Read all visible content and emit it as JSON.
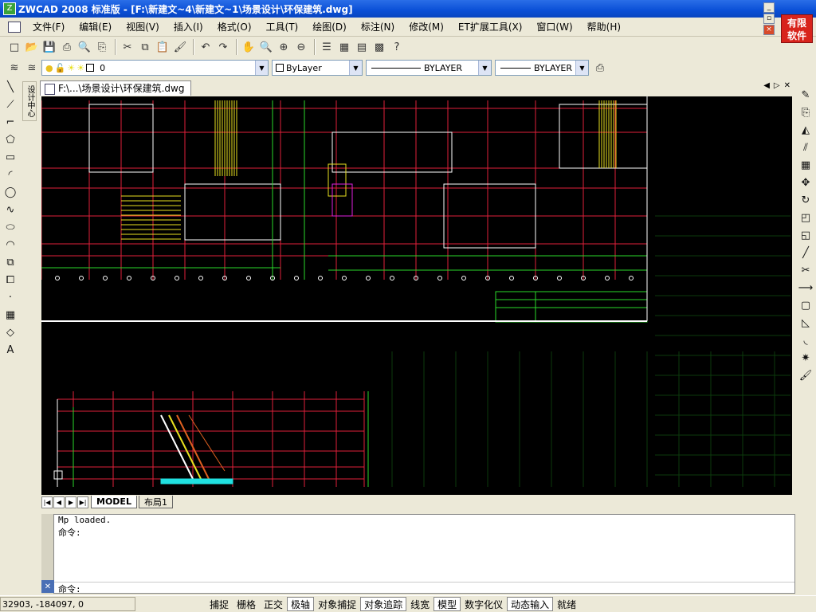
{
  "titlebar": {
    "title": "ZWCAD 2008 标准版 - [F:\\新建文~4\\新建文~1\\场景设计\\环保建筑.dwg]",
    "app_icon": "Z"
  },
  "logo": {
    "line1": "有限",
    "line2": "软件"
  },
  "menu": {
    "items": [
      "文件(F)",
      "编辑(E)",
      "视图(V)",
      "插入(I)",
      "格式(O)",
      "工具(T)",
      "绘图(D)",
      "标注(N)",
      "修改(M)",
      "ET扩展工具(X)",
      "窗口(W)",
      "帮助(H)"
    ]
  },
  "toolbar1": {
    "icons": [
      "new-icon",
      "open-icon",
      "save-icon",
      "print-icon",
      "preview-icon",
      "plot-icon",
      "cut-icon",
      "copy-icon",
      "paste-icon",
      "matchprop-icon",
      "undo-icon",
      "redo-icon",
      "pan-icon",
      "zoom-realtime-icon",
      "zoom-window-icon",
      "zoom-previous-icon",
      "properties-icon",
      "design-center-icon",
      "tool-palette-icon",
      "calculator-icon",
      "help-icon"
    ]
  },
  "toolbar2": {
    "layer_value": "0",
    "color_value": "ByLayer",
    "linetype_value": "BYLAYER",
    "lineweight_value": "BYLAYER"
  },
  "left_tools": [
    "line-icon",
    "construction-line-icon",
    "polyline-icon",
    "polygon-icon",
    "rectangle-icon",
    "arc-icon",
    "circle-icon",
    "spline-icon",
    "ellipse-icon",
    "ellipse-arc-icon",
    "insert-block-icon",
    "make-block-icon",
    "point-icon",
    "hatch-icon",
    "region-icon",
    "text-icon"
  ],
  "left_tool_glyphs": [
    "╲",
    "⟋",
    "⌐",
    "⬠",
    "▭",
    "◜",
    "◯",
    "∿",
    "⬭",
    "◠",
    "⧉",
    "⧠",
    "·",
    "▦",
    "◇",
    "A"
  ],
  "vertical_label": "设计中心",
  "right_tools": [
    "erase-icon",
    "copy-object-icon",
    "mirror-icon",
    "offset-icon",
    "array-icon",
    "move-icon",
    "rotate-icon",
    "scale-icon",
    "stretch-icon",
    "lengthen-icon",
    "trim-icon",
    "extend-icon",
    "break-icon",
    "chamfer-icon",
    "fillet-icon",
    "explode-icon",
    "paint-icon"
  ],
  "right_tool_glyphs": [
    "✎",
    "⎘",
    "◭",
    "⫽",
    "▦",
    "✥",
    "↻",
    "◰",
    "◱",
    "╱",
    "✂",
    "⟶",
    "▢",
    "◺",
    "◟",
    "✷",
    "🖌"
  ],
  "doc_tab": {
    "label": "F:\\...\\场景设计\\环保建筑.dwg"
  },
  "layout_tabs": [
    "MODEL",
    "布局1"
  ],
  "command": {
    "lines": [
      "Mp loaded.",
      "命令:"
    ],
    "prompt": "命令:"
  },
  "statusbar": {
    "coords": "32903, -184097, 0",
    "buttons": [
      "捕捉",
      "栅格",
      "正交",
      "极轴",
      "对象捕捉",
      "对象追踪",
      "线宽",
      "模型",
      "数字化仪",
      "动态输入",
      "就绪"
    ],
    "on_buttons": [
      "极轴",
      "对象追踪",
      "模型",
      "动态输入"
    ]
  },
  "colors": {
    "canvas_bg": "#000000",
    "grid_red": "#e0203a",
    "wall_white": "#ffffff",
    "green": "#2ad82a",
    "yellow": "#e8e020",
    "cyan": "#20e0e0",
    "magenta": "#e020e0"
  }
}
